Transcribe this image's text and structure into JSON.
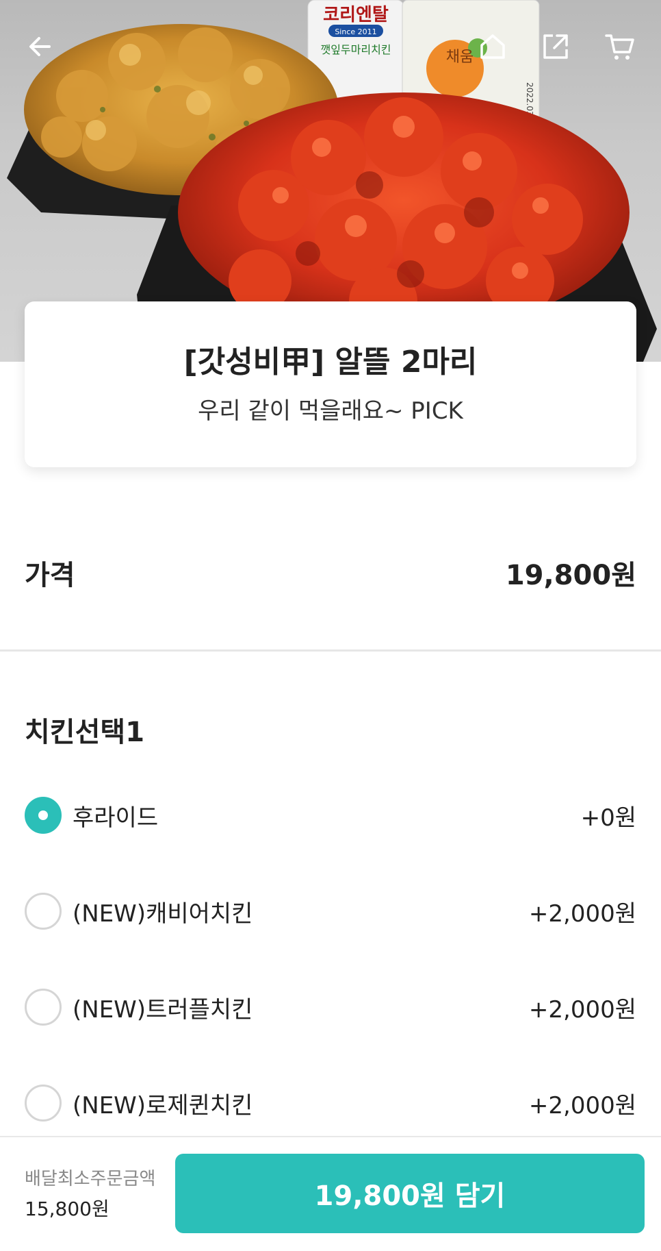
{
  "header": {
    "icons": [
      "back-arrow-icon",
      "home-icon",
      "share-icon",
      "cart-icon"
    ]
  },
  "hero": {
    "package_brand_line1": "코리엔탈",
    "package_brand_line2": "Since 2011",
    "package_brand_line3": "깻잎두마리치킨",
    "pack_label": "채움",
    "pack_date": "2022.03.21"
  },
  "product": {
    "name": "[갓성비甲] 알뜰 2마리",
    "description": "우리 같이 먹을래요~ PICK"
  },
  "price": {
    "label": "가격",
    "value": "19,800원"
  },
  "options": {
    "title": "치킨선택1",
    "items": [
      {
        "label": "후라이드",
        "price": "+0원",
        "selected": true
      },
      {
        "label": "(NEW)캐비어치킨",
        "price": "+2,000원",
        "selected": false
      },
      {
        "label": "(NEW)트러플치킨",
        "price": "+2,000원",
        "selected": false
      },
      {
        "label": "(NEW)로제퀸치킨",
        "price": "+2,000원",
        "selected": false
      }
    ]
  },
  "footer": {
    "min_order_label": "배달최소주문금액",
    "min_order_value": "15,800원",
    "add_button_label": "19,800원 담기"
  },
  "colors": {
    "accent": "#2bbfb8",
    "text": "#222222",
    "muted": "#888888"
  }
}
